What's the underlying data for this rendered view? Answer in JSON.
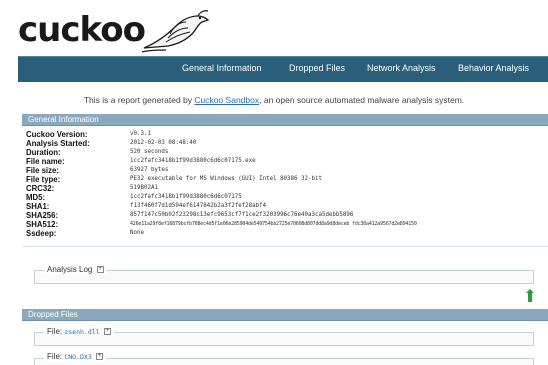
{
  "app": {
    "logo_text": "cuckoo"
  },
  "nav": {
    "items": [
      {
        "label": "General Information"
      },
      {
        "label": "Dropped Files"
      },
      {
        "label": "Network Analysis"
      },
      {
        "label": "Behavior Analysis"
      }
    ]
  },
  "intro": {
    "prefix": "This is a report generated by ",
    "link": "Cuckoo Sandbox",
    "suffix": ", an open source automated malware analysis system."
  },
  "general_info": {
    "title": "General Information",
    "rows": [
      {
        "label": "Cuckoo Version:",
        "value": "v0.3.1"
      },
      {
        "label": "Analysis Started:",
        "value": "2012-02-03 08:48:40"
      },
      {
        "label": "Duration:",
        "value": "520 seconds"
      },
      {
        "label": "File name:",
        "value": "1cc2fafc3418b1f99d3880c6d6c07175.exe"
      },
      {
        "label": "File size:",
        "value": "63927 bytes"
      },
      {
        "label": "File type:",
        "value": "PE32 executable for MS Windows (GUI) Intel 80386 32-bit"
      },
      {
        "label": "CRC32:",
        "value": "519B02A1"
      },
      {
        "label": "MD5:",
        "value": "1cc2fafc3418b1f99d3880c6d6c07175"
      },
      {
        "label": "SHA1:",
        "value": "f13f460f7d1d594ef6147842b2a3f2fef28abf4"
      },
      {
        "label": "SHA256:",
        "value": "857f147c50b02f23298c13efc9653cf7f1ce2f3203996c76e40a3ca5debb5896"
      },
      {
        "label": "SHA512:",
        "value": "426e11a29f8ef16879bcfb708ec4d5f1e06e285904de549754bb2725e70608d807dd8a9d8deceb fdc30a412a9567d2e894150"
      },
      {
        "label": "Ssdeep:",
        "value": "None"
      }
    ]
  },
  "analysis_log": {
    "label": "Analysis Log",
    "toggle": "+"
  },
  "dropped_files": {
    "title": "Dropped Files",
    "files": [
      {
        "label": "File:",
        "name": "zsenh.dll",
        "toggle": "+"
      },
      {
        "label": "File:",
        "name": "CNO.DX3",
        "toggle": "+"
      }
    ]
  }
}
